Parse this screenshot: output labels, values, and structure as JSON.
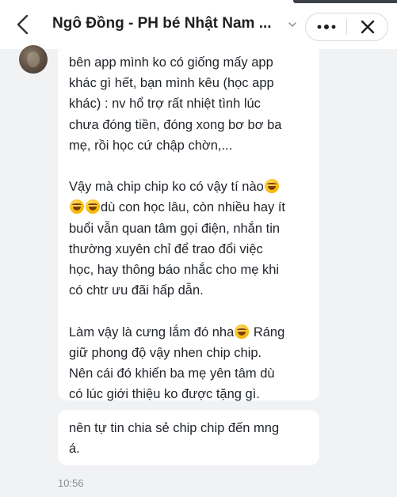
{
  "header": {
    "title": "Ngô Đồng - PH bé Nhật Nam ...",
    "back_icon": "chevron-left-icon",
    "dropdown_icon": "chevron-down-icon",
    "more_icon": "more-horizontal-icon",
    "close_icon": "close-icon"
  },
  "messages": [
    {
      "paragraphs": [
        [
          "bên app mình ko có giống mấy app",
          "khác gì hết, bạn mình kêu (học app",
          "khác) : nv hổ trợ rất nhiệt tình lúc",
          "chưa đóng tiền, đóng xong bơ bơ ba",
          "mẹ, rồi học cứ chập chờn,..."
        ],
        [
          "Vậy mà chip chip ko có vậy tí nào",
          "dù con học lâu, còn nhiều hay ít",
          "buổi vẫn quan tâm gọi điện, nhắn tin",
          "thường xuyên chỉ để trao đổi việc",
          "học, hay thông báo nhắc cho mẹ khi",
          "có chtr ưu đãi hấp dẫn."
        ],
        [
          "Làm vậy là cưng lắm đó nha",
          " Ráng",
          "giữ phong độ vậy nhen chip chip.",
          "Nên cái đó khiến ba mẹ yên tâm dù",
          "có lúc giới thiệu ko được tặng gì."
        ]
      ]
    },
    {
      "lines": [
        "nên tự tin chia sẻ chip chip đến mng",
        "á."
      ]
    }
  ],
  "timestamp": "10:56",
  "emoji_name": "rolling-on-the-floor-laughing-emoji"
}
